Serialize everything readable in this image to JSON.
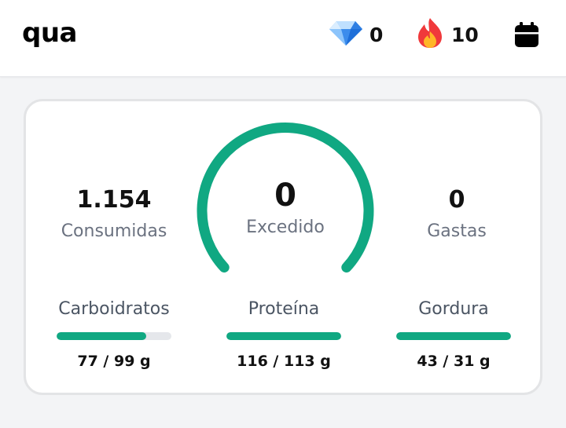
{
  "header": {
    "day_label": "qua",
    "gems": {
      "icon": "diamond-icon",
      "value": "0"
    },
    "streak": {
      "icon": "fire-icon",
      "value": "10"
    },
    "calendar_icon": "calendar-icon"
  },
  "summary": {
    "consumed": {
      "value": "1.154",
      "label": "Consumidas"
    },
    "remaining": {
      "value": "0",
      "label": "Excedido",
      "gauge_fill": 1.0
    },
    "burned": {
      "value": "0",
      "label": "Gastas"
    }
  },
  "macros": [
    {
      "name": "Carboidratos",
      "value": "77 / 99 g",
      "progress": 0.78
    },
    {
      "name": "Proteína",
      "value": "116 / 113 g",
      "progress": 1.0
    },
    {
      "name": "Gordura",
      "value": "43 / 31 g",
      "progress": 1.0
    }
  ],
  "colors": {
    "accent": "#10a882",
    "track": "#e5e7eb",
    "muted_text": "#6b7280"
  }
}
